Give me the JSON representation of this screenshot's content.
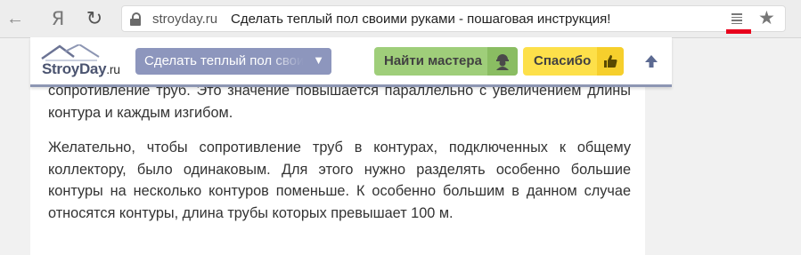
{
  "browser": {
    "back_icon": "arrow-left-icon",
    "yandex_label": "Я",
    "reload_icon": "reload-icon",
    "domain": "stroyday.ru",
    "page_title": "Сделать теплый пол своими руками - пошаговая инструкция!",
    "reader_icon": "reader-mode-icon",
    "bookmark_icon": "star-icon",
    "colors": {
      "reader_underline": "#e8001c"
    }
  },
  "header": {
    "logo_name": "StroyDay",
    "logo_suffix": ".ru",
    "dropdown_selected": "Сделать теплый пол своими руками",
    "find_master_label": "Найти мастера",
    "find_master_icon": "worker-icon",
    "thanks_label": "Спасибо",
    "thanks_icon": "thumbs-up-icon",
    "scroll_up_icon": "arrow-up-icon",
    "colors": {
      "dropdown_bg": "#8d96bd",
      "find_master_bg": "#9fce7a",
      "thanks_bg": "#fde04a",
      "accent": "#5c6a92"
    }
  },
  "article": {
    "paragraphs": [
      "сопротивление труб. Это значение повышается параллельно с увеличением длины контура и каждым изгибом.",
      "Желательно, чтобы сопротивление труб в контурах, подключенных к общему коллектору, было одинаковым. Для этого нужно разделять особенно большие контуры на несколько контуров поменьше. К особенно большим в данном случае относятся контуры, длина трубы которых превышает 100 м."
    ]
  }
}
